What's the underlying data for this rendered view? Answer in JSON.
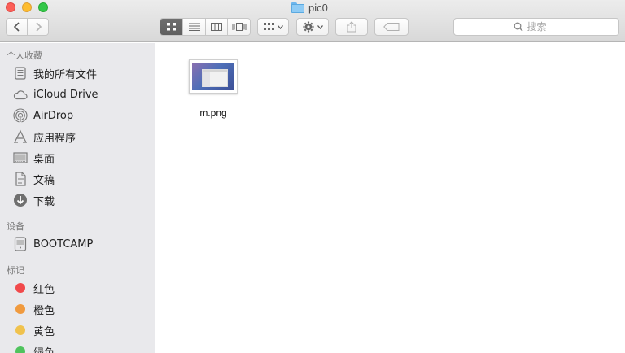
{
  "window": {
    "title": "pic0"
  },
  "search": {
    "placeholder": "搜索"
  },
  "sidebar": {
    "sections": [
      {
        "title": "个人收藏"
      },
      {
        "title": "设备"
      },
      {
        "title": "标记"
      }
    ],
    "favorites": [
      {
        "label": "我的所有文件",
        "icon": "all-files-icon"
      },
      {
        "label": "iCloud Drive",
        "icon": "cloud-icon"
      },
      {
        "label": "AirDrop",
        "icon": "airdrop-icon"
      },
      {
        "label": "应用程序",
        "icon": "applications-icon"
      },
      {
        "label": "桌面",
        "icon": "desktop-icon"
      },
      {
        "label": "文稿",
        "icon": "documents-icon"
      },
      {
        "label": "下载",
        "icon": "download-icon"
      }
    ],
    "devices": [
      {
        "label": "BOOTCAMP",
        "icon": "drive-icon"
      }
    ],
    "tags": [
      {
        "label": "红色",
        "color": "#f1494b"
      },
      {
        "label": "橙色",
        "color": "#f09a3e"
      },
      {
        "label": "黄色",
        "color": "#f0c24d"
      },
      {
        "label": "绿色",
        "color": "#4fc35d"
      }
    ]
  },
  "files": [
    {
      "name": "m.png"
    }
  ]
}
